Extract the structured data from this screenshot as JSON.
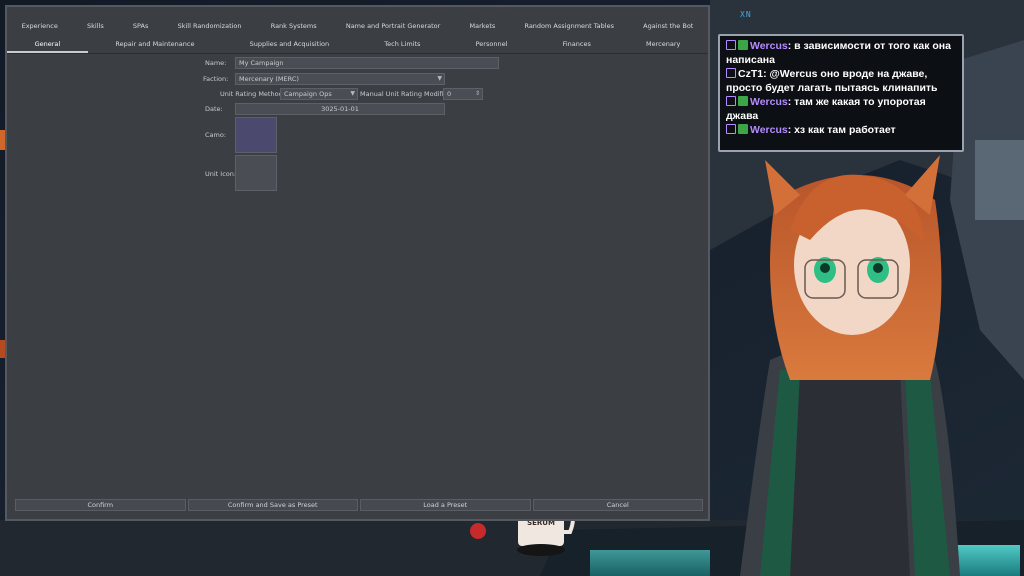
{
  "tabs_row1": [
    "Experience",
    "Skills",
    "SPAs",
    "Skill Randomization",
    "Rank Systems",
    "Name and Portrait Generator",
    "Markets",
    "Random Assignment Tables",
    "Against the Bot"
  ],
  "tabs_row2": [
    "General",
    "Repair and Maintenance",
    "Supplies and Acquisition",
    "Tech Limits",
    "Personnel",
    "Finances",
    "Mercenary"
  ],
  "active_tab_row2": 0,
  "form": {
    "name_label": "Name:",
    "name_value": "My Campaign",
    "faction_label": "Faction:",
    "faction_value": "Mercenary (MERC)",
    "unit_rating_label": "Unit Rating Method:",
    "unit_rating_value": "Campaign Ops",
    "manual_rating_label": "Manual Unit Rating Modifier:",
    "manual_rating_value": "0",
    "date_label": "Date:",
    "date_value": "3025-01-01",
    "camo_label": "Camo:",
    "unit_icon_label": "Unit Icon:"
  },
  "buttons": [
    "Confirm",
    "Confirm and Save as Preset",
    "Load a Preset",
    "Cancel"
  ],
  "chat": {
    "header": "XN",
    "messages": [
      {
        "user": "Wercus",
        "text": "в зависимости от того как она написана",
        "user_color": "#b58cff"
      },
      {
        "user": "CzT1",
        "text": "@Wercus оно вроде на джаве, просто будет лагать пытаясь клинапить",
        "user_color": "#ffffff"
      },
      {
        "user": "Wercus",
        "text": "там же какая то упоротая джава",
        "user_color": "#b58cff"
      },
      {
        "user": "Wercus",
        "text": "хз как там работает",
        "user_color": "#b58cff"
      }
    ]
  },
  "mug_text": "CATGIRL SERUM",
  "colors": {
    "window_bg": "#3b3f44",
    "camo_swatch": "#4b4a6e",
    "icon_swatch": "#4a4e54",
    "twitch_purple": "#b58cff"
  }
}
